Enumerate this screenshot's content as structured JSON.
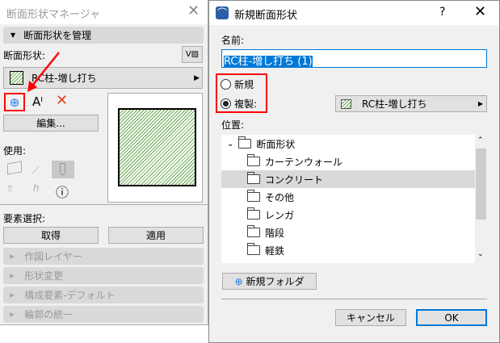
{
  "manager": {
    "title": "断面形状マネージャ",
    "section_manage": "断面形状を管理",
    "profile_label": "断面形状:",
    "profile_value": "RC柱-増し打ち",
    "edit_button": "編集...",
    "usage_label": "使用:",
    "element_select_label": "要素選択:",
    "get_button": "取得",
    "apply_button": "適用",
    "collapsed_sections": [
      "作図レイヤー",
      "形状変更",
      "構成要素-デフォルト",
      "輪郭の統一"
    ]
  },
  "dialog": {
    "title": "新規断面形状",
    "help": "?",
    "name_label": "名前:",
    "name_value": "RC柱-増し打ち (1)",
    "radio_new": "新規",
    "radio_duplicate": "複製:",
    "duplicate_source": "RC柱-増し打ち",
    "location_label": "位置:",
    "tree_root": "断面形状",
    "tree_items": [
      "カーテンウォール",
      "コンクリート",
      "その他",
      "レンガ",
      "階段",
      "軽鉄"
    ],
    "selected_item": "コンクリート",
    "new_folder_button": "新規フォルダ",
    "cancel_button": "キャンセル",
    "ok_button": "OK"
  },
  "colors": {
    "accent": "#0078d7",
    "highlight": "#ff0000",
    "hatch": "#6aa84f"
  }
}
